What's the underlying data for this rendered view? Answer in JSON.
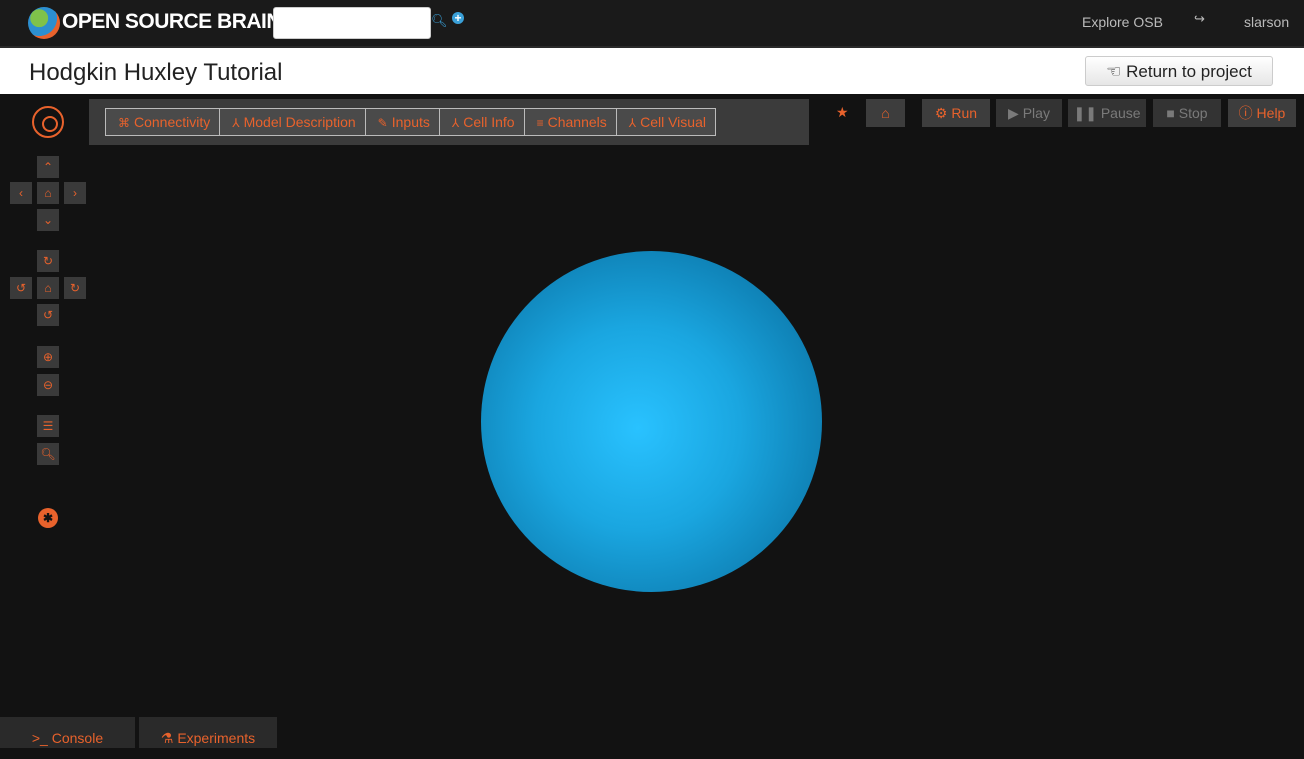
{
  "header": {
    "brand": "OPEN SOURCE BRAIN",
    "search_placeholder": "",
    "explore": "Explore OSB",
    "user": "slarson"
  },
  "page": {
    "title": "Hodgkin Huxley Tutorial",
    "return_label": "Return to project"
  },
  "tabs": [
    {
      "label": "Connectivity",
      "icon": "network-icon"
    },
    {
      "label": "Model Description",
      "icon": "neuron-icon"
    },
    {
      "label": "Inputs",
      "icon": "pencil-icon"
    },
    {
      "label": "Cell Info",
      "icon": "neuron-icon"
    },
    {
      "label": "Channels",
      "icon": "channel-icon"
    },
    {
      "label": "Cell Visual",
      "icon": "neuron-icon"
    }
  ],
  "toolbar": {
    "run": "Run",
    "play": "Play",
    "pause": "Pause",
    "stop": "Stop",
    "help": "Help"
  },
  "bottom": {
    "console": "Console",
    "experiments": "Experiments"
  },
  "colors": {
    "accent": "#e8622c",
    "background": "#121212",
    "sphere": "#1aa6e0"
  }
}
